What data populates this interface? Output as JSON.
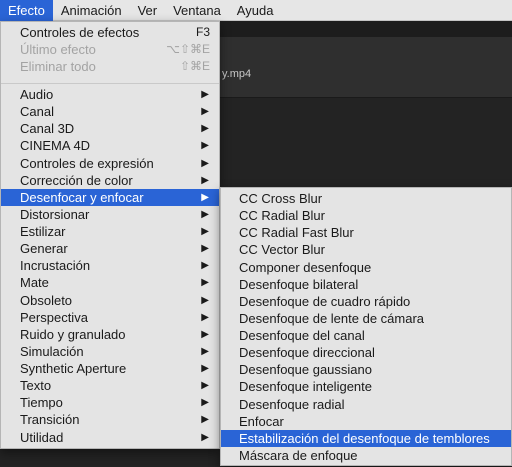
{
  "menubar": {
    "items": [
      "Efecto",
      "Animación",
      "Ver",
      "Ventana",
      "Ayuda"
    ],
    "active_index": 0
  },
  "background": {
    "file_label": "y.mp4"
  },
  "main_menu": {
    "top_items": [
      {
        "label": "Controles de efectos",
        "shortcut": "F3",
        "disabled": false
      },
      {
        "label": "Último efecto",
        "shortcut": "⌥⇧⌘E",
        "disabled": true
      },
      {
        "label": "Eliminar todo",
        "shortcut": "⇧⌘E",
        "disabled": true
      }
    ],
    "categories": [
      "Audio",
      "Canal",
      "Canal 3D",
      "CINEMA 4D",
      "Controles de expresión",
      "Corrección de color",
      "Desenfocar y enfocar",
      "Distorsionar",
      "Estilizar",
      "Generar",
      "Incrustación",
      "Mate",
      "Obsoleto",
      "Perspectiva",
      "Ruido y granulado",
      "Simulación",
      "Synthetic Aperture",
      "Texto",
      "Tiempo",
      "Transición",
      "Utilidad"
    ],
    "highlighted_category": "Desenfocar y enfocar",
    "submenu_arrow": "▶"
  },
  "sub_menu": {
    "items": [
      "CC Cross Blur",
      "CC Radial Blur",
      "CC Radial Fast Blur",
      "CC Vector Blur",
      "Componer desenfoque",
      "Desenfoque bilateral",
      "Desenfoque de cuadro rápido",
      "Desenfoque de lente de cámara",
      "Desenfoque del canal",
      "Desenfoque direccional",
      "Desenfoque gaussiano",
      "Desenfoque inteligente",
      "Desenfoque radial",
      "Enfocar",
      "Estabilización del desenfoque de temblores",
      "Máscara de enfoque"
    ],
    "highlighted_item": "Estabilización del desenfoque de temblores"
  },
  "colors": {
    "highlight": "#2a64d6",
    "menu_bg": "#e4e4e4",
    "disabled_text": "#a3a3a3"
  }
}
